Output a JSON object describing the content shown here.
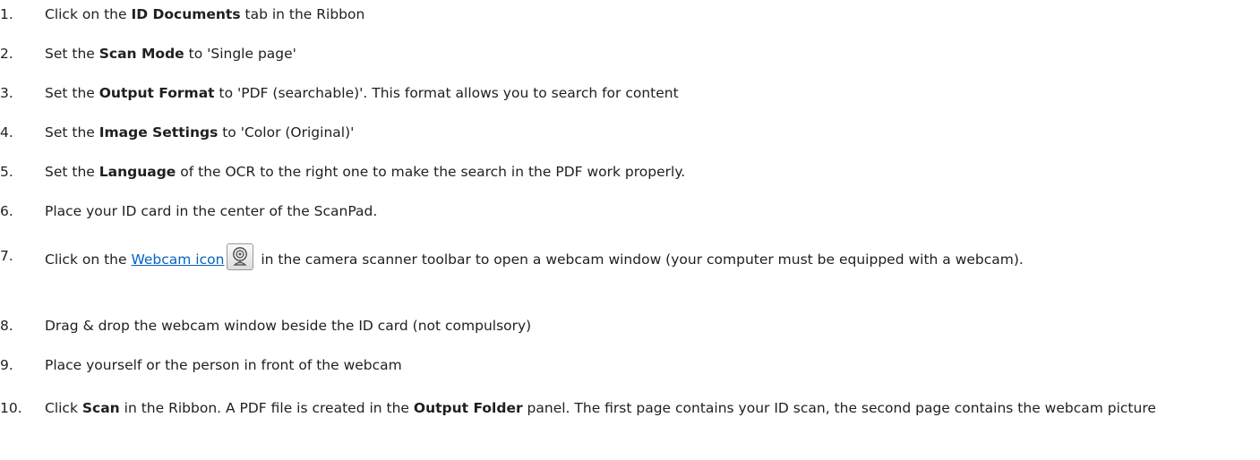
{
  "steps": [
    {
      "num": "1.",
      "pre": "Click on the ",
      "bold": "ID Documents",
      "post": " tab in the Ribbon"
    },
    {
      "num": "2.",
      "pre": "Set the ",
      "bold": "Scan Mode",
      "post": " to 'Single page'"
    },
    {
      "num": "3.",
      "pre": "Set the ",
      "bold": "Output Format",
      "post": " to 'PDF (searchable)'. This format allows you to search for content"
    },
    {
      "num": "4.",
      "pre": "Set the ",
      "bold": "Image Settings",
      "post": " to 'Color (Original)'"
    },
    {
      "num": "5.",
      "pre": "Set the ",
      "bold": "Language",
      "post": " of the OCR to the right one to make the search in the PDF work properly."
    },
    {
      "num": "6.",
      "text": "Place your ID card in the center of the ScanPad."
    },
    {
      "num": "7.",
      "pre": "Click on the ",
      "link": "Webcam icon",
      "icon": "webcam-icon",
      "post": " in the camera scanner toolbar to open a webcam window (your computer must be equipped with a webcam)."
    },
    {
      "num": "8.",
      "text": "Drag & drop the webcam window beside the ID card (not compulsory)"
    },
    {
      "num": "9.",
      "text": "Place yourself or the person in front of the webcam"
    },
    {
      "num": "10.",
      "pre": "Click ",
      "bold": "Scan",
      "mid": " in the Ribbon. A PDF file is created in the ",
      "bold2": "Output Folder",
      "post": " panel. The first page contains your ID scan, the second page contains the webcam picture"
    }
  ],
  "colors": {
    "text": "#1f1f1f",
    "link": "#0563c1"
  }
}
